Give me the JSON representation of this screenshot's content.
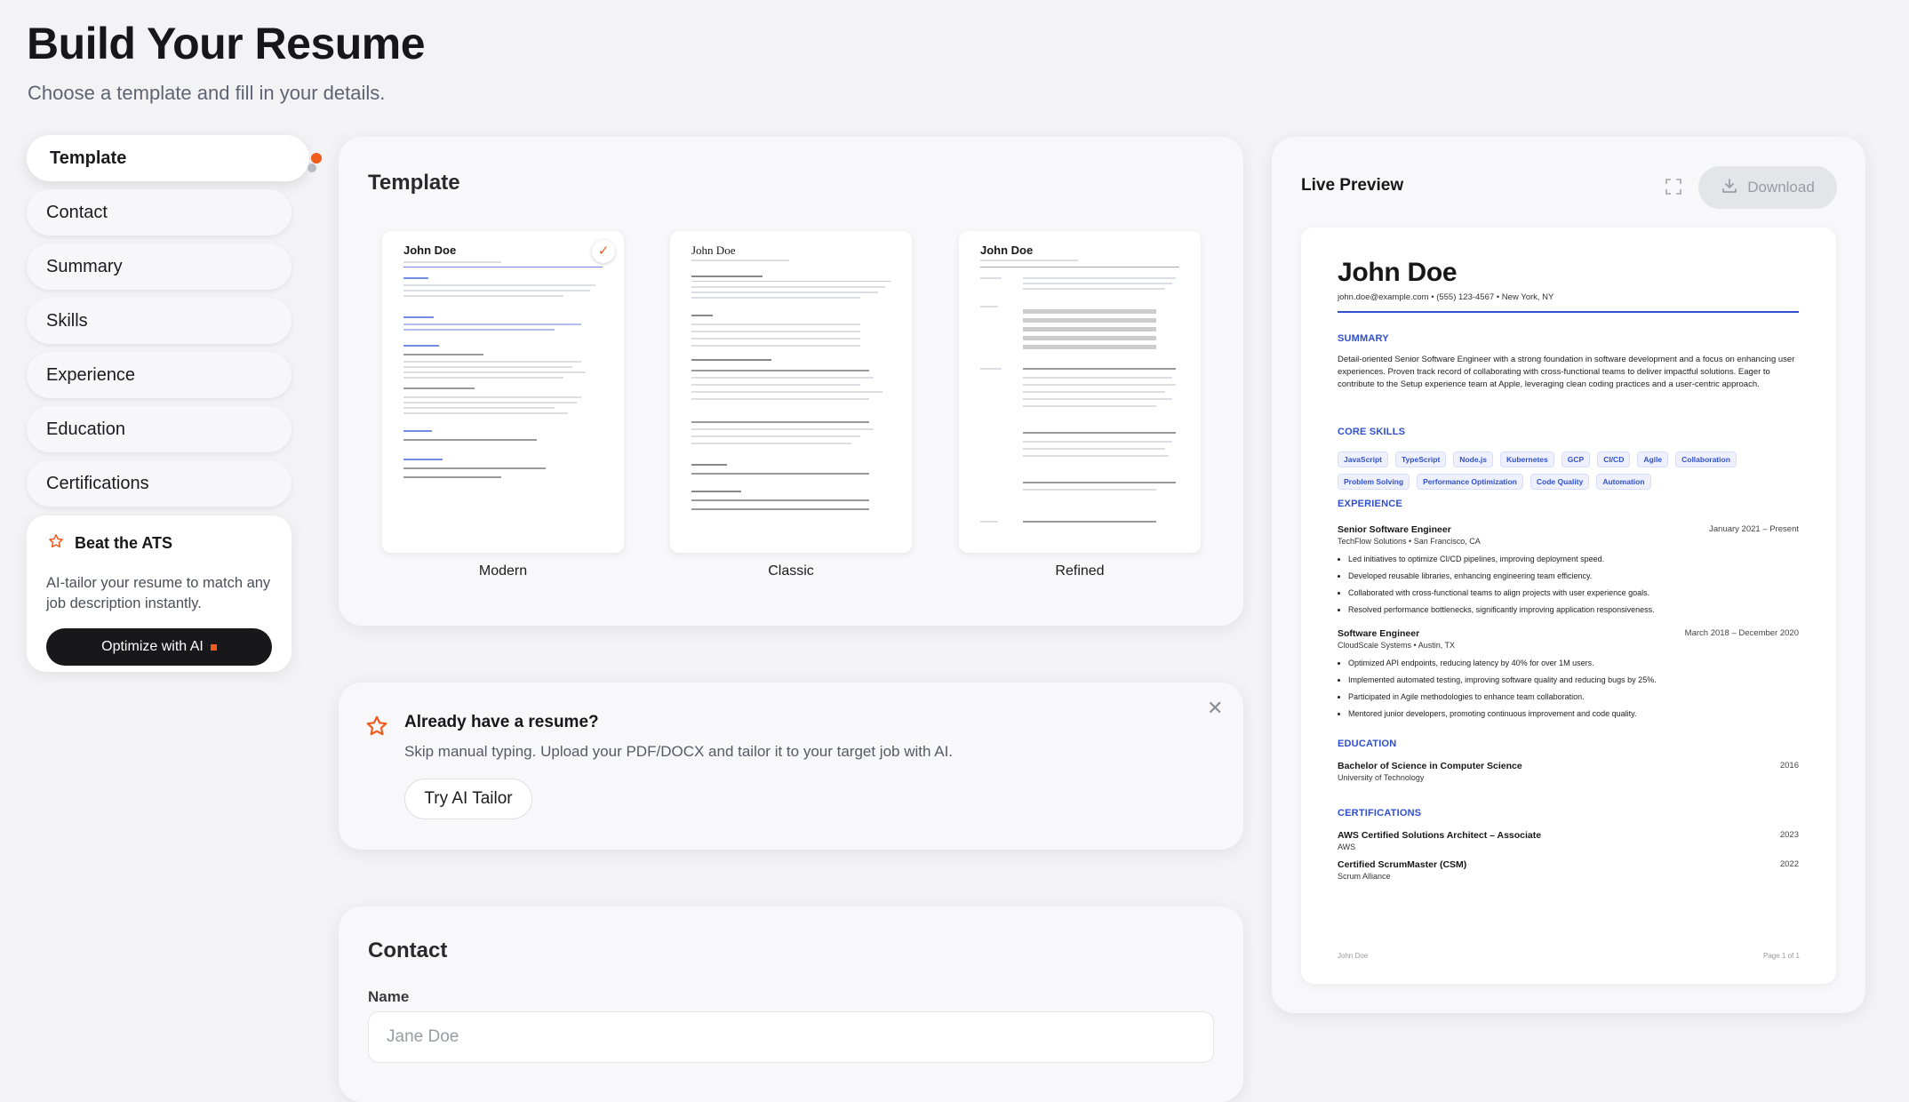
{
  "header": {
    "title": "Build Your Resume",
    "subtitle": "Choose a template and fill in your details."
  },
  "sidebar": {
    "items": [
      {
        "label": "Template"
      },
      {
        "label": "Contact"
      },
      {
        "label": "Summary"
      },
      {
        "label": "Skills"
      },
      {
        "label": "Experience"
      },
      {
        "label": "Education"
      },
      {
        "label": "Certifications"
      }
    ],
    "active": "Template"
  },
  "ats": {
    "title": "Beat the ATS",
    "description": "AI-tailor your resume to match any job description instantly.",
    "button": "Optimize with AI"
  },
  "templates": {
    "title": "Template",
    "options": [
      {
        "label": "Modern",
        "selected": true
      },
      {
        "label": "Classic",
        "selected": false
      },
      {
        "label": "Refined",
        "selected": false
      }
    ],
    "thumb_name": "John Doe"
  },
  "upload": {
    "title": "Already have a resume?",
    "description": "Skip manual typing. Upload your PDF/DOCX and tailor it to your target job with AI.",
    "button": "Try AI Tailor"
  },
  "contact": {
    "title": "Contact",
    "name_label": "Name",
    "name_placeholder": "Jane Doe"
  },
  "preview": {
    "title": "Live Preview",
    "download": "Download",
    "resume": {
      "name": "John Doe",
      "contact": "john.doe@example.com • (555) 123-4567 • New York, NY",
      "summary_heading": "SUMMARY",
      "summary": "Detail-oriented Senior Software Engineer with a strong foundation in software development and a focus on enhancing user experiences. Proven track record of collaborating with cross-functional teams to deliver impactful solutions. Eager to contribute to the Setup experience team at Apple, leveraging clean coding practices and a user-centric approach.",
      "skills_heading": "CORE SKILLS",
      "skills": [
        "JavaScript",
        "TypeScript",
        "Node.js",
        "Kubernetes",
        "GCP",
        "CI/CD",
        "Agile",
        "Collaboration",
        "Problem Solving",
        "Performance Optimization",
        "Code Quality",
        "Automation"
      ],
      "experience_heading": "EXPERIENCE",
      "jobs": [
        {
          "title": "Senior Software Engineer",
          "dates": "January 2021 – Present",
          "company": "TechFlow Solutions • San Francisco, CA",
          "bullets": [
            "Led initiatives to optimize CI/CD pipelines, improving deployment speed.",
            "Developed reusable libraries, enhancing engineering team efficiency.",
            "Collaborated with cross-functional teams to align projects with user experience goals.",
            "Resolved performance bottlenecks, significantly improving application responsiveness."
          ]
        },
        {
          "title": "Software Engineer",
          "dates": "March 2018 – December 2020",
          "company": "CloudScale Systems • Austin, TX",
          "bullets": [
            "Optimized API endpoints, reducing latency by 40% for over 1M users.",
            "Implemented automated testing, improving software quality and reducing bugs by 25%.",
            "Participated in Agile methodologies to enhance team collaboration.",
            "Mentored junior developers, promoting continuous improvement and code quality."
          ]
        }
      ],
      "education_heading": "EDUCATION",
      "education": {
        "degree": "Bachelor of Science in Computer Science",
        "school": "University of Technology",
        "year": "2016"
      },
      "certifications_heading": "CERTIFICATIONS",
      "certifications": [
        {
          "name": "AWS Certified Solutions Architect – Associate",
          "issuer": "AWS",
          "year": "2023"
        },
        {
          "name": "Certified ScrumMaster (CSM)",
          "issuer": "Scrum Alliance",
          "year": "2022"
        }
      ],
      "footer_left": "John Doe",
      "footer_right": "Page 1 of 1"
    }
  },
  "colors": {
    "accent": "#f05a1a",
    "resume_blue": "#2f4fcf",
    "dark_button": "#18181b"
  },
  "icons": {
    "ats": "star-icon",
    "upload": "star-icon",
    "close": "close-icon",
    "expand": "expand-icon",
    "download": "download-icon",
    "check": "check-icon"
  }
}
